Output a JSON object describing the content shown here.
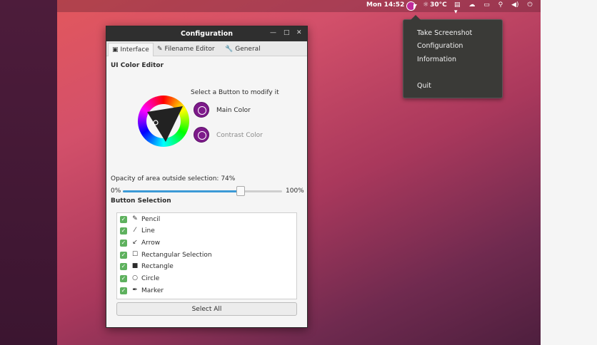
{
  "topbar": {
    "clock": "Mon 14:52",
    "temperature": "30°C",
    "tray_icons": [
      "clipboard-icon",
      "cloud-icon",
      "network-wired-icon",
      "network-icon",
      "volume-icon",
      "power-icon",
      "dropdown-arrow-icon"
    ]
  },
  "tray_menu": {
    "items": [
      "Take Screenshot",
      "Configuration",
      "Information",
      "Quit"
    ]
  },
  "window": {
    "title": "Configuration",
    "tabs": [
      {
        "label": "Interface",
        "icon": "window-icon"
      },
      {
        "label": "Filename Editor",
        "icon": "edit-icon"
      },
      {
        "label": "General",
        "icon": "wrench-icon"
      }
    ],
    "color_editor": {
      "section_title": "UI Color Editor",
      "prompt": "Select a Button to modify it",
      "main_color_label": "Main Color",
      "contrast_color_label": "Contrast Color",
      "main_color": "#7d1a8a",
      "contrast_color": "#7d1a8a"
    },
    "opacity": {
      "label": "Opacity of area outside selection: 74%",
      "min_label": "0%",
      "max_label": "100%",
      "value_percent": 74
    },
    "button_selection": {
      "section_title": "Button Selection",
      "items": [
        {
          "label": "Pencil",
          "icon": "pencil-icon",
          "checked": true
        },
        {
          "label": "Line",
          "icon": "line-icon",
          "checked": true
        },
        {
          "label": "Arrow",
          "icon": "arrow-icon",
          "checked": true
        },
        {
          "label": "Rectangular Selection",
          "icon": "rect-selection-icon",
          "checked": true
        },
        {
          "label": "Rectangle",
          "icon": "rectangle-icon",
          "checked": true
        },
        {
          "label": "Circle",
          "icon": "circle-icon",
          "checked": true
        },
        {
          "label": "Marker",
          "icon": "marker-icon",
          "checked": true
        }
      ],
      "select_all_label": "Select All"
    }
  },
  "colors": {
    "accent": "#3c9ad6",
    "check": "#5eb15e",
    "titlebar": "#2f2f2f"
  }
}
